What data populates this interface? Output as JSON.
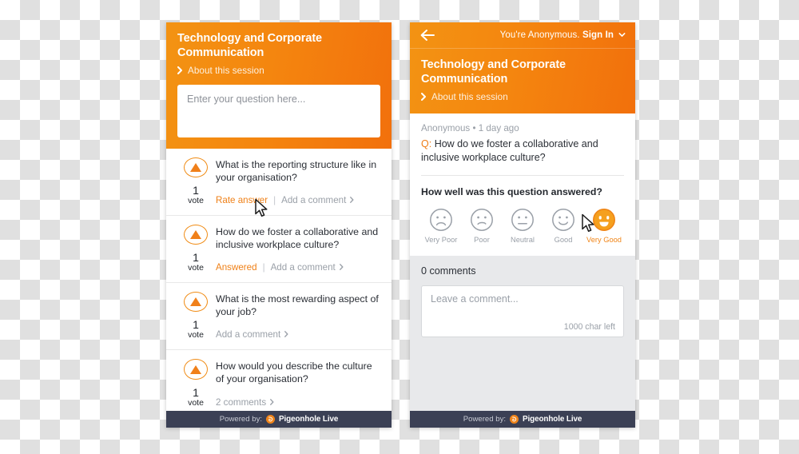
{
  "session": {
    "title": "Technology and Corporate Communication",
    "about_label": "About this session"
  },
  "left_panel": {
    "ask_placeholder": "Enter your question here...",
    "questions": [
      {
        "votes": "1",
        "votes_label": "vote",
        "text": "What is the reporting structure like in your organisation?",
        "primary_action": "Rate answer",
        "primary_action_style": "orange",
        "separator": "|",
        "secondary_action": "Add a comment"
      },
      {
        "votes": "1",
        "votes_label": "vote",
        "text": "How do we foster a collaborative and inclusive workplace culture?",
        "primary_action": "Answered",
        "primary_action_style": "orange",
        "separator": "|",
        "secondary_action": "Add a comment"
      },
      {
        "votes": "1",
        "votes_label": "vote",
        "text": "What is the most rewarding aspect of your job?",
        "primary_action": "",
        "primary_action_style": "none",
        "separator": "",
        "secondary_action": "Add a comment"
      },
      {
        "votes": "1",
        "votes_label": "vote",
        "text": "How would you describe the culture of your organisation?",
        "primary_action": "",
        "primary_action_style": "none",
        "separator": "",
        "secondary_action": "2 comments"
      }
    ]
  },
  "right_panel": {
    "signin_prefix": "You're Anonymous.",
    "signin_action": "Sign In",
    "question": {
      "author": "Anonymous",
      "dot": "•",
      "time": "1 day ago",
      "prefix": "Q:",
      "text": "How do we foster a collaborative and inclusive workplace culture?"
    },
    "rating": {
      "title": "How well was this question answered?",
      "options": [
        {
          "label": "Very Poor",
          "selected": false
        },
        {
          "label": "Poor",
          "selected": false
        },
        {
          "label": "Neutral",
          "selected": false
        },
        {
          "label": "Good",
          "selected": false
        },
        {
          "label": "Very Good",
          "selected": true
        }
      ]
    },
    "comments": {
      "count_label": "0 comments",
      "placeholder": "Leave a comment...",
      "char_counter": "1000 char left"
    }
  },
  "footer": {
    "powered_by": "Powered by:",
    "brand": "Pigeonhole Live"
  },
  "colors": {
    "orange": "#f08518",
    "orange_dark": "#f2700c",
    "footer_bg": "#3b4055",
    "comment_bg": "#e8e9eb"
  }
}
